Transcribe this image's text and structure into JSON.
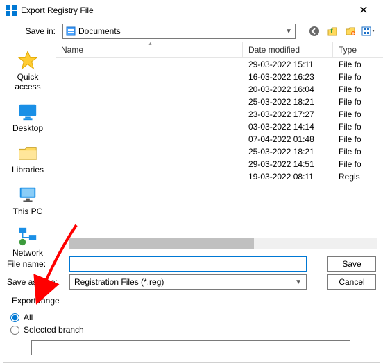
{
  "title": "Export Registry File",
  "save_in_label": "Save in:",
  "save_in_value": "Documents",
  "columns": {
    "name": "Name",
    "date": "Date modified",
    "type": "Type"
  },
  "rows": [
    {
      "name": "",
      "date": "29-03-2022 15:11",
      "type": "File fo"
    },
    {
      "name": "",
      "date": "16-03-2022 16:23",
      "type": "File fo"
    },
    {
      "name": "",
      "date": "20-03-2022 16:04",
      "type": "File fo"
    },
    {
      "name": "",
      "date": "25-03-2022 18:21",
      "type": "File fo"
    },
    {
      "name": "",
      "date": "23-03-2022 17:27",
      "type": "File fo"
    },
    {
      "name": "",
      "date": "03-03-2022 14:14",
      "type": "File fo"
    },
    {
      "name": "",
      "date": "07-04-2022 01:48",
      "type": "File fo"
    },
    {
      "name": "",
      "date": "25-03-2022 18:21",
      "type": "File fo"
    },
    {
      "name": "",
      "date": "29-03-2022 14:51",
      "type": "File fo"
    },
    {
      "name": "",
      "date": "19-03-2022 08:11",
      "type": "Regis"
    }
  ],
  "places": {
    "quick": "Quick access",
    "desktop": "Desktop",
    "libraries": "Libraries",
    "thispc": "This PC",
    "network": "Network"
  },
  "filename_label": "File name:",
  "filename_value": "",
  "savetype_label": "Save as type:",
  "savetype_value": "Registration Files (*.reg)",
  "save_btn": "Save",
  "cancel_btn": "Cancel",
  "export_range_label": "Export range",
  "radio_all": "All",
  "radio_branch": "Selected branch"
}
